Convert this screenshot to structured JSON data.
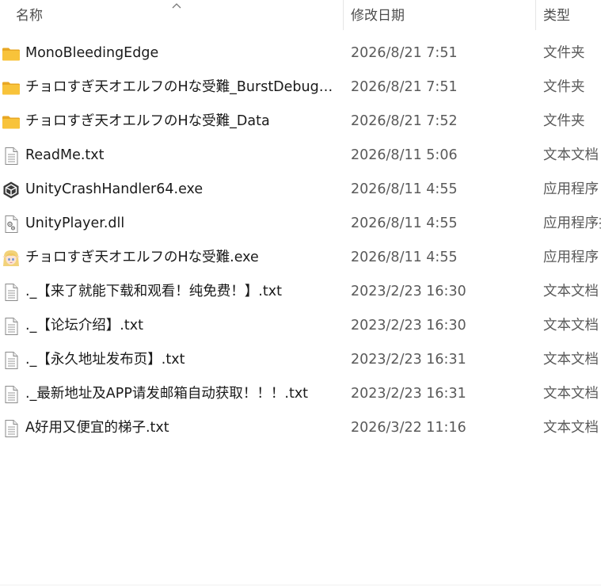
{
  "header": {
    "columns": {
      "name": "名称",
      "date": "修改日期",
      "type": "类型"
    },
    "sort_icon": "chevron-up-icon"
  },
  "files": [
    {
      "name": "MonoBleedingEdge",
      "date": "2026/8/21 7:51",
      "type": "文件夹",
      "icon": "folder-icon"
    },
    {
      "name": "チョロすぎ天オエルフのHな受難_BurstDebug…",
      "date": "2026/8/21 7:51",
      "type": "文件夹",
      "icon": "folder-icon"
    },
    {
      "name": "チョロすぎ天オエルフのHな受難_Data",
      "date": "2026/8/21 7:52",
      "type": "文件夹",
      "icon": "folder-icon"
    },
    {
      "name": "ReadMe.txt",
      "date": "2026/8/11 5:06",
      "type": "文本文档",
      "icon": "text-file-icon"
    },
    {
      "name": "UnityCrashHandler64.exe",
      "date": "2026/8/11 4:55",
      "type": "应用程序",
      "icon": "unity-icon"
    },
    {
      "name": "UnityPlayer.dll",
      "date": "2026/8/11 4:55",
      "type": "应用程序扩展",
      "icon": "dll-file-icon"
    },
    {
      "name": "チョロすぎ天オエルフのHな受難.exe",
      "date": "2026/8/11 4:55",
      "type": "应用程序",
      "icon": "elf-app-icon"
    },
    {
      "name": "._【来了就能下载和观看！纯免费！】.txt",
      "date": "2023/2/23 16:30",
      "type": "文本文档",
      "icon": "text-file-icon"
    },
    {
      "name": "._【论坛介绍】.txt",
      "date": "2023/2/23 16:30",
      "type": "文本文档",
      "icon": "text-file-icon"
    },
    {
      "name": "._【永久地址发布页】.txt",
      "date": "2023/2/23 16:31",
      "type": "文本文档",
      "icon": "text-file-icon"
    },
    {
      "name": "._最新地址及APP请发邮箱自动获取！！！.txt",
      "date": "2023/2/23 16:31",
      "type": "文本文档",
      "icon": "text-file-icon"
    },
    {
      "name": "A好用又便宜的梯子.txt",
      "date": "2026/3/22 11:16",
      "type": "文本文档",
      "icon": "text-file-icon"
    }
  ],
  "colors": {
    "folder": "#f8c33a",
    "folder_dark": "#e8a723",
    "text_primary": "#1a1a1a",
    "text_secondary": "#5a5a5a",
    "header_text": "#4d4d4d"
  }
}
